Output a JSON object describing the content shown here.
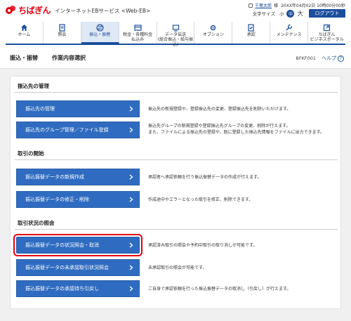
{
  "header": {
    "logo_text": "ちばぎん",
    "service_name": "インターネットEBサービス <Web-EB>",
    "user_name": "千葉太郎",
    "user_suffix": "様",
    "last_login": "20XX年04月02日 10時00分00秒",
    "font_size_label": "文字サイズ",
    "size_small": "小",
    "size_medium": "中",
    "size_large": "大",
    "logout": "ログアウト"
  },
  "nav": {
    "items": [
      {
        "label": "ホーム",
        "icon": "home-icon"
      },
      {
        "label": "照会",
        "icon": "inquiry-icon"
      },
      {
        "label": "振込・振替",
        "icon": "transfer-icon"
      },
      {
        "label": "税金・各種料金\n払込み",
        "icon": "tax-payment-icon"
      },
      {
        "label": "データ伝送\n(総合振込・給与振込)",
        "icon": "data-transmission-icon"
      },
      {
        "label": "オプション",
        "icon": "option-icon"
      },
      {
        "label": "承認",
        "icon": "approval-icon"
      },
      {
        "label": "メンテナンス",
        "icon": "maintenance-icon"
      },
      {
        "label": "ちばぎん\nビジネスポータル",
        "icon": "portal-icon"
      }
    ]
  },
  "page": {
    "title": "振込・振替",
    "subtitle": "作業内容選択",
    "screen_id": "BFKF001",
    "help": "ヘルプ"
  },
  "sections": [
    {
      "title": "振込先の管理",
      "items": [
        {
          "label": "振込先の管理",
          "desc": "振込先の新規登録や、登録振込先の変更、登録振込先を削除いただけます。"
        },
        {
          "label": "振込先のグループ管理／ファイル登録",
          "desc": "振込先グループの新規登録や登録振込先グループの変更、削除が行えます。\nまた、ファイルによる振込先の登録や、既に登録した振込先情報をファイルに出力できます。"
        }
      ]
    },
    {
      "title": "取引の開始",
      "items": [
        {
          "label": "振込振替データの新規作成",
          "desc": "承認者へ承認依頼を行う振込振替データの作成が行えます。"
        },
        {
          "label": "振込振替データの修正・削除",
          "desc": "作成途中やエラーとなった取引を修正、削除できます。"
        }
      ]
    },
    {
      "title": "取引状況の照会",
      "items": [
        {
          "label": "振込振替データの状況照会・取消",
          "desc": "承認済み取引の照会や予約中取引の取り消しが可能です。"
        },
        {
          "label": "振込振替データの未承認取引状況照会",
          "desc": "未承認取引の照会が可能です。"
        },
        {
          "label": "振込振替データの承認待ち引戻し",
          "desc": "ご自身で承認依頼を行った振込振替データの取消し（引戻し）が行えます。"
        }
      ]
    }
  ],
  "colors": {
    "brand_red": "#e60012",
    "primary_blue": "#2f6cc1",
    "nav_blue": "#1a4e9c"
  }
}
